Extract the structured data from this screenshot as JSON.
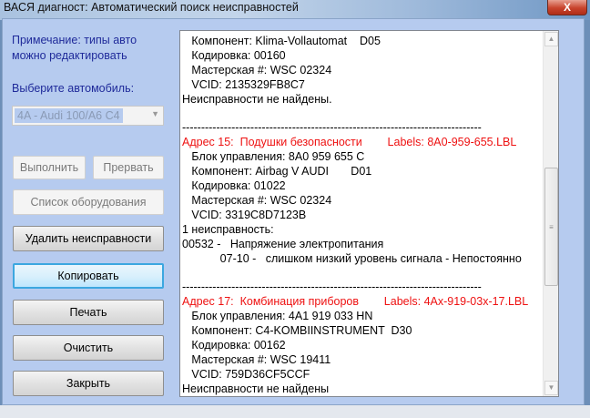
{
  "window": {
    "title": "ВАСЯ диагност: Автоматический поиск неисправностей",
    "close": "X"
  },
  "left": {
    "note_line1": "Примечание: типы авто",
    "note_line2": "можно редактировать",
    "select_label": "Выберите автомобиль:",
    "car_selected": "4A - Audi 100/A6 C4",
    "buttons": {
      "run": "Выполнить",
      "abort": "Прервать",
      "equipment": "Список оборудования",
      "clear_faults": "Удалить неисправности",
      "copy": "Копировать",
      "print": "Печать",
      "clear": "Очистить",
      "close": "Закрыть"
    }
  },
  "log": {
    "lines": [
      {
        "text": "   Компонент: Klima-Vollautomat    D05"
      },
      {
        "text": "   Кодировка: 00160"
      },
      {
        "text": "   Мастерская #: WSC 02324"
      },
      {
        "text": "   VCID: 2135329FB8C7"
      },
      {
        "text": "Неисправности не найдены."
      },
      {
        "text": " "
      },
      {
        "text": "-------------------------------------------------------------------------------"
      },
      {
        "text": "Адрес 15:  Подушки безопасности        Labels: 8A0-959-655.LBL",
        "red": true
      },
      {
        "text": "   Блок управления: 8A0 959 655 C"
      },
      {
        "text": "   Компонент: Airbag V AUDI       D01"
      },
      {
        "text": "   Кодировка: 01022"
      },
      {
        "text": "   Мастерская #: WSC 02324"
      },
      {
        "text": "   VCID: 3319C8D7123B"
      },
      {
        "text": "1 неисправность:"
      },
      {
        "text": "00532 -   Напряжение электропитания"
      },
      {
        "text": "            07-10 -   слишком низкий уровень сигнала - Непостоянно"
      },
      {
        "text": " "
      },
      {
        "text": "-------------------------------------------------------------------------------"
      },
      {
        "text": "Адрес 17:  Комбинация приборов        Labels: 4Ax-919-03x-17.LBL",
        "red": true
      },
      {
        "text": "   Блок управления: 4A1 919 033 HN"
      },
      {
        "text": "   Компонент: C4-KOMBIINSTRUMENT  D30"
      },
      {
        "text": "   Кодировка: 00162"
      },
      {
        "text": "   Мастерская #: WSC 19411"
      },
      {
        "text": "   VCID: 759D36CF5CCF"
      },
      {
        "text": "Неисправности не найдены"
      }
    ]
  },
  "colors": {
    "accent_red": "#ee1111",
    "label_blue": "#1f2a9a",
    "client_bg": "#b6cbef"
  }
}
